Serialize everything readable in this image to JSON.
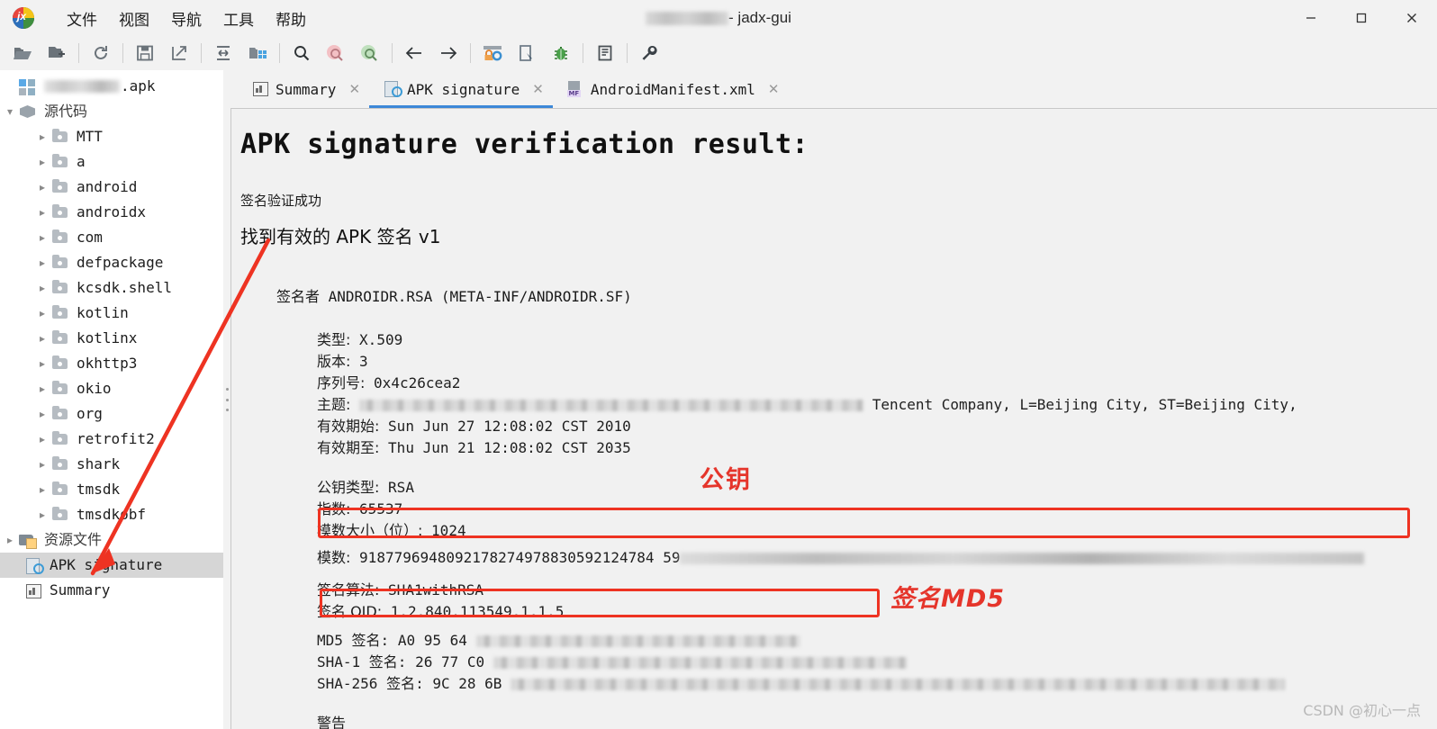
{
  "window": {
    "title_suffix": " - jadx-gui",
    "title_redacted": true,
    "logo_name": "jadx-logo",
    "controls": {
      "minimize": "—",
      "maximize": "□",
      "close": "✕"
    }
  },
  "menubar": {
    "items": [
      {
        "label": "文件",
        "name": "menu-file"
      },
      {
        "label": "视图",
        "name": "menu-view"
      },
      {
        "label": "导航",
        "name": "menu-navigation"
      },
      {
        "label": "工具",
        "name": "menu-tools"
      },
      {
        "label": "帮助",
        "name": "menu-help"
      }
    ]
  },
  "toolbar": {
    "buttons": [
      {
        "name": "open-file-icon",
        "glyph": "open-folder"
      },
      {
        "name": "add-files-icon",
        "glyph": "folder-plus"
      },
      {
        "sep": true
      },
      {
        "name": "reload-icon",
        "glyph": "refresh"
      },
      {
        "sep": true
      },
      {
        "name": "save-all-icon",
        "glyph": "save"
      },
      {
        "name": "export-gradle-icon",
        "glyph": "export-arrow"
      },
      {
        "sep": true
      },
      {
        "name": "collapse-all-icon",
        "glyph": "collapse"
      },
      {
        "name": "flatten-packages-icon",
        "glyph": "packages"
      },
      {
        "sep": true
      },
      {
        "name": "search-icon",
        "glyph": "magnifier"
      },
      {
        "name": "search-class-icon",
        "glyph": "magnifier-pink"
      },
      {
        "name": "search-comment-icon",
        "glyph": "magnifier-green"
      },
      {
        "sep": true
      },
      {
        "name": "back-icon",
        "glyph": "arrow-left"
      },
      {
        "name": "forward-icon",
        "glyph": "arrow-right"
      },
      {
        "sep": true
      },
      {
        "name": "deobfuscation-icon",
        "glyph": "lock-gear"
      },
      {
        "name": "quark-icon",
        "glyph": "device"
      },
      {
        "name": "debugger-icon",
        "glyph": "bug"
      },
      {
        "sep": true
      },
      {
        "name": "log-viewer-icon",
        "glyph": "log"
      },
      {
        "sep": true
      },
      {
        "name": "preferences-icon",
        "glyph": "wrench"
      }
    ]
  },
  "sidebar": {
    "root": {
      "label": ".apk",
      "redacted": true,
      "icon": "apk-icon"
    },
    "source_node": {
      "label": "源代码",
      "icon": "source-box-icon",
      "expanded": true
    },
    "packages": [
      "MTT",
      "a",
      "android",
      "androidx",
      "com",
      "defpackage",
      "kcsdk.shell",
      "kotlin",
      "kotlinx",
      "okhttp3",
      "okio",
      "org",
      "retrofit2",
      "shark",
      "tmsdk",
      "tmsdkobf"
    ],
    "resources_node": {
      "label": "资源文件",
      "icon": "resources-folder-icon"
    },
    "apk_signature_node": {
      "label": "APK signature",
      "icon": "signature-icon",
      "selected": true
    },
    "summary_node": {
      "label": "Summary",
      "icon": "summary-icon",
      "selected": false
    }
  },
  "tabs": [
    {
      "label": "Summary",
      "icon": "summary-icon",
      "active": false,
      "close": "✕"
    },
    {
      "label": "APK signature",
      "icon": "signature-icon",
      "active": true,
      "close": "✕"
    },
    {
      "label": "AndroidManifest.xml",
      "icon": "manifest-icon",
      "active": false,
      "close": "✕"
    }
  ],
  "viewer": {
    "title": "APK signature verification result:",
    "status_ok": "签名验证成功",
    "found_signature": "找到有效的 APK 签名 v1",
    "signer_label": "签名者",
    "signer_value": "ANDROIDR.RSA (META-INF/ANDROIDR.SF)",
    "fields": [
      {
        "key": "类型:",
        "value": "X.509",
        "name": "cert-type"
      },
      {
        "key": "版本:",
        "value": "3",
        "name": "cert-version"
      },
      {
        "key": "序列号:",
        "value": "0x4c26cea2",
        "name": "serial-number"
      },
      {
        "key": "主题:",
        "value": "Tencent Company, L=Beijing City, ST=Beijing City,",
        "redacted_prefix": true,
        "name": "subject"
      },
      {
        "key": "有效期始:",
        "value": "Sun Jun 27 12:08:02 CST 2010",
        "name": "valid-from"
      },
      {
        "key": "有效期至:",
        "value": "Thu Jun 21 12:08:02 CST 2035",
        "name": "valid-to"
      }
    ],
    "fields2": [
      {
        "key": "公钥类型:",
        "value": "RSA",
        "name": "public-key-type"
      },
      {
        "key": "指数:",
        "value": "65537",
        "name": "exponent"
      },
      {
        "key": "模数大小（位）:",
        "value": "1024",
        "name": "modulus-size"
      },
      {
        "key": "模数:",
        "value": "9187796948092178274978830592124784 59",
        "redacted_suffix": true,
        "name": "modulus",
        "highlighted": true
      }
    ],
    "fields3": [
      {
        "key": "签名算法:",
        "value": "SHA1withRSA",
        "name": "signature-algorithm"
      },
      {
        "key": "签名 OID:",
        "value": "1.2.840.113549.1.1.5",
        "name": "signature-oid"
      }
    ],
    "digests": [
      {
        "key": "MD5 签名:",
        "value": "A0 95 64",
        "redacted_suffix": true,
        "name": "md5-digest",
        "highlighted": true
      },
      {
        "key": "SHA-1 签名:",
        "value": "26 77 C0",
        "redacted_suffix": true,
        "name": "sha1-digest"
      },
      {
        "key": "SHA-256 签名:",
        "value": "9C 28 6B",
        "redacted_suffix": true,
        "name": "sha256-digest"
      }
    ],
    "warning_label": "警告"
  },
  "annotations": {
    "public_key": "公钥",
    "signature_md5": "签名MD5",
    "arrow_target": "APK signature tree node",
    "color": "#ee3322"
  },
  "watermark": "CSDN @初心一点",
  "colors": {
    "accent": "#3d88d8",
    "annotation_red": "#ee3322",
    "selection_gray": "#d6d6d6",
    "window_bg": "#f2f2f2",
    "editor_bg": "#f1f1f1"
  }
}
